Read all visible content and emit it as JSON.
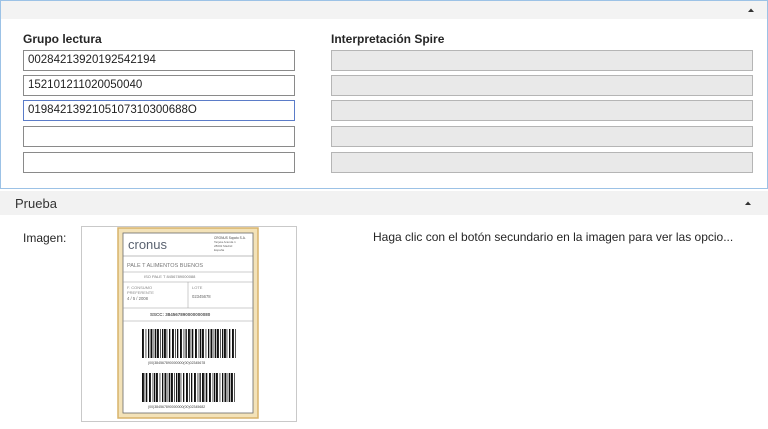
{
  "lectura": {
    "group_title": "Grupo lectura",
    "interp_title": "Interpretación Spire",
    "inputs": [
      "00284213920192542194",
      "152101211020050040",
      "0198421392105107310300688O",
      "",
      ""
    ]
  },
  "prueba": {
    "title": "Prueba",
    "image_label": "Imagen:",
    "hint": "Haga clic con el botón secundario en la imagen para ver las opcio..."
  },
  "label_image": {
    "brand": "cronus",
    "company_lines": [
      "CRONUS Sopoto S.A.",
      "Tarjeta Aranda 1",
      "28002 Madrid",
      "España"
    ],
    "product": "PALE T ALIMENTOS BUENOS",
    "id_row": "ISO PALE T     8456789000088",
    "left_block": [
      "F. CONSUMO",
      "PREFERENTE",
      "4 / 5 / 2008"
    ],
    "right_block": [
      "LOTE",
      "02345678"
    ],
    "sscc": "SSCC: 384567890000000080",
    "barcode1_text": "(00)384567890000000(00)02345678",
    "barcode2_text": "(00)384567890000000(00)02345682"
  },
  "colors": {
    "accent_border": "#9cc2e6",
    "header_bg": "#f3f3f3",
    "readonly_bg": "#e9e9e9",
    "label_border": "#d8b36a",
    "label_bg": "#f3e2b8"
  },
  "icons": {
    "collapse": "chevron-up-icon"
  }
}
